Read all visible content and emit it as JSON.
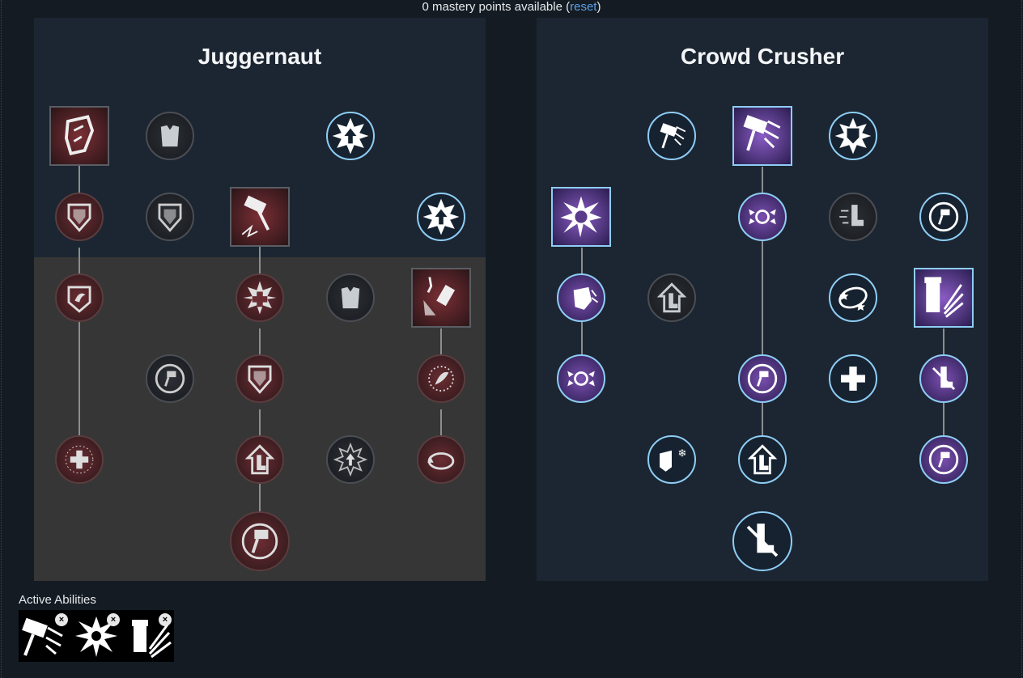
{
  "status": {
    "prefix": "0 mastery points available (",
    "reset_label": "reset",
    "suffix": ")"
  },
  "trees": [
    {
      "title": "Juggernaut"
    },
    {
      "title": "Crowd Crusher"
    }
  ],
  "active_abilities": {
    "label": "Active Abilities",
    "slots": [
      {
        "icon": "hammer-charge-icon",
        "close": "×"
      },
      {
        "icon": "shockwave-burst-icon",
        "close": "×"
      },
      {
        "icon": "hammer-slam-icon",
        "close": "×"
      }
    ]
  },
  "colors": {
    "accent": "#8ecdf5",
    "link": "#5aa0e6",
    "active_purple": "#7a4fb0",
    "juggernaut_red": "#6a2d33"
  }
}
